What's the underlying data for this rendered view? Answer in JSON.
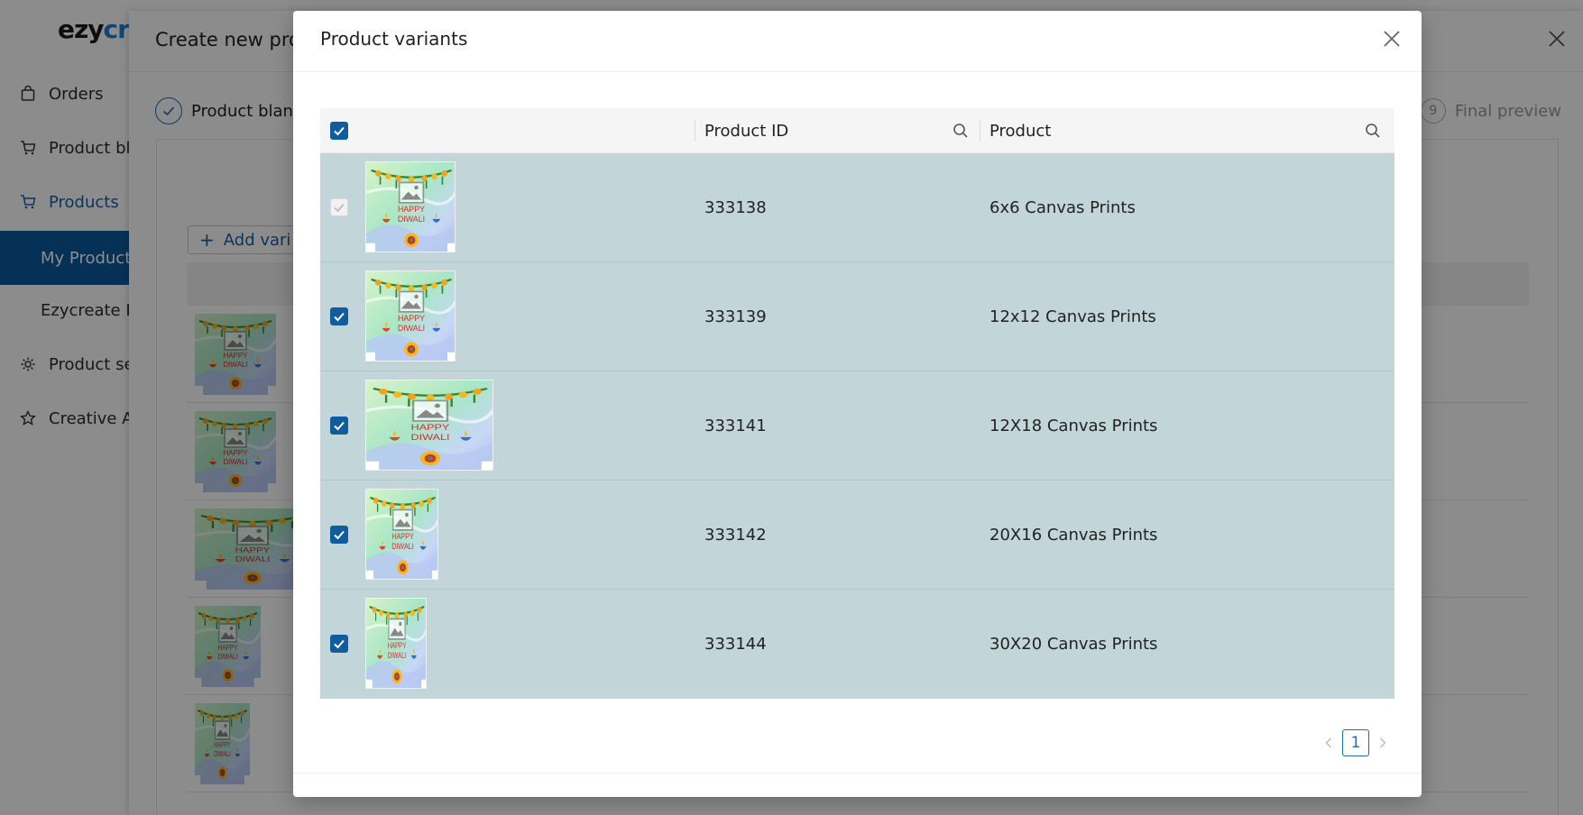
{
  "app": {
    "logo_part1": "ezy",
    "logo_part2": "cre",
    "sidebar": {
      "items": [
        {
          "label": "Orders",
          "icon": "bag-icon"
        },
        {
          "label": "Product bl",
          "icon": "cart-icon"
        },
        {
          "label": "Products",
          "icon": "cart-icon"
        },
        {
          "label": "My Product",
          "icon": ""
        },
        {
          "label": "Ezycreate P",
          "icon": ""
        },
        {
          "label": "Product se",
          "icon": "gear-icon"
        },
        {
          "label": "Creative A",
          "icon": "star-icon"
        }
      ]
    },
    "panel": {
      "title": "Create new pro",
      "step_first_label": "Product blan",
      "step_final_number": "9",
      "step_final_label": "Final preview",
      "add_variant_label": "Add vari"
    }
  },
  "modal": {
    "title": "Product variants",
    "columns": {
      "product_id": "Product ID",
      "product": "Product"
    },
    "rows": [
      {
        "product_id": "333138",
        "product": "6x6 Canvas Prints",
        "checked": true,
        "disabled": true
      },
      {
        "product_id": "333139",
        "product": "12x12 Canvas Prints",
        "checked": true,
        "disabled": false
      },
      {
        "product_id": "333141",
        "product": "12X18 Canvas Prints",
        "checked": true,
        "disabled": false
      },
      {
        "product_id": "333142",
        "product": "20X16 Canvas Prints",
        "checked": true,
        "disabled": false
      },
      {
        "product_id": "333144",
        "product": "30X20 Canvas Prints",
        "checked": true,
        "disabled": false
      }
    ],
    "thumbnail_text": "HAPPY DIWALI",
    "pagination": {
      "current_page": "1"
    }
  },
  "colors": {
    "accent": "#0f5c9e",
    "row_selected_bg": "#c2d5d8",
    "sidebar_selected_bg": "#0b5a9d"
  }
}
